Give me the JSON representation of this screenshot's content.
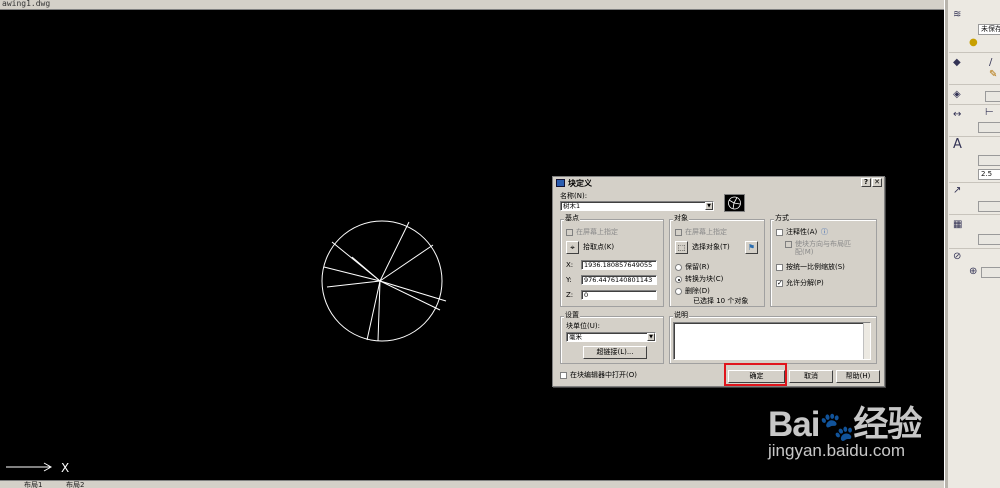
{
  "window": {
    "title": "awing1.dwg"
  },
  "status_bar": {
    "tab_layout": "布局1",
    "tab_layout2": "布局2"
  },
  "ucs": {
    "x_label": "X"
  },
  "palette": {
    "layer_value": "未保存",
    "text_height": "2.5"
  },
  "dialog": {
    "title": "块定义",
    "help_button": "?",
    "close_button": "✕",
    "name_label": "名称(N):",
    "name_value": "树木1",
    "base_point": {
      "caption": "基点",
      "specify_on_screen": "在屏幕上指定",
      "pick_point": "拾取点(K)",
      "x_label": "X:",
      "x_value": "1936.180857649055",
      "y_label": "Y:",
      "y_value": "976.4476140801143",
      "z_label": "Z:",
      "z_value": "0"
    },
    "objects": {
      "caption": "对象",
      "specify_on_screen": "在屏幕上指定",
      "select_objects": "选择对象(T)",
      "retain": "保留(R)",
      "convert_to_block": "转换为块(C)",
      "delete": "删除(D)",
      "selected_count": "已选择 10 个对象",
      "selected_option": "convert_to_block"
    },
    "behavior": {
      "caption": "方式",
      "annotative": "注释性(A)",
      "match_orientation": "使块方向与布局匹配(M)",
      "scale_uniformly": "按统一比例缩放(S)",
      "allow_exploding": "允许分解(P)",
      "annotative_checked": false,
      "scale_uniformly_checked": false,
      "allow_exploding_checked": true
    },
    "settings": {
      "caption": "设置",
      "block_unit_label": "块单位(U):",
      "block_unit_value": "毫米",
      "hyperlink": "超链接(L)..."
    },
    "description": {
      "caption": "说明",
      "value": ""
    },
    "open_in_editor": "在块编辑器中打开(O)",
    "ok": "确定",
    "cancel": "取消",
    "help": "帮助(H)",
    "accent_highlight": "#e0151c"
  },
  "watermark": {
    "logo": "Bai都经验",
    "url": "jingyan.baidu.com"
  }
}
